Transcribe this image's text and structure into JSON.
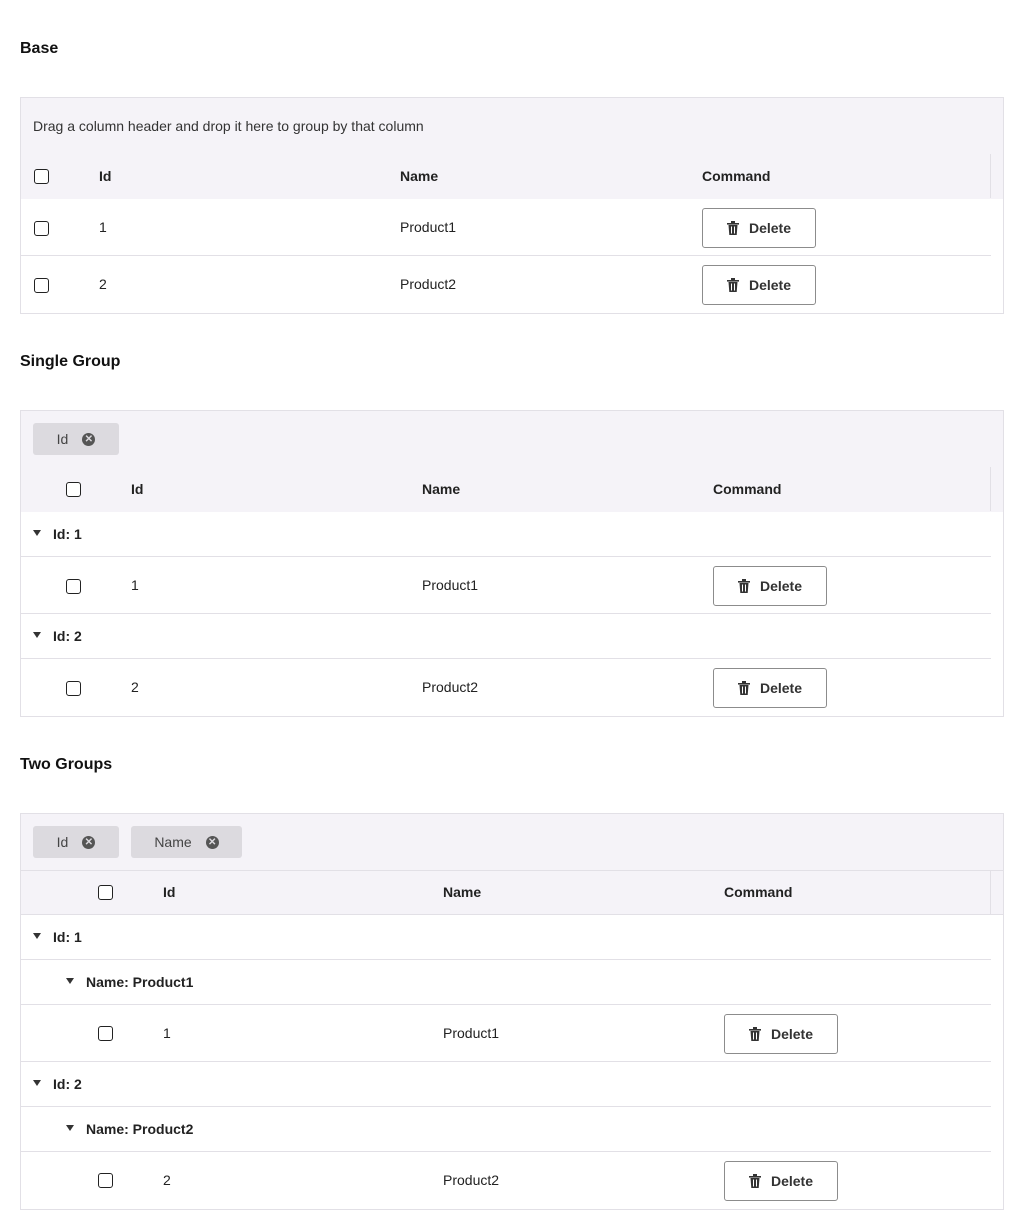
{
  "sections": {
    "base": {
      "title": "Base"
    },
    "single": {
      "title": "Single Group"
    },
    "two": {
      "title": "Two Groups"
    }
  },
  "group_hint": "Drag a column header and drop it here to group by that column",
  "columns": {
    "id": "Id",
    "name": "Name",
    "command": "Command"
  },
  "chips": {
    "id": "Id",
    "name": "Name"
  },
  "delete_label": "Delete",
  "rows": [
    {
      "id": "1",
      "name": "Product1"
    },
    {
      "id": "2",
      "name": "Product2"
    }
  ],
  "groups": {
    "id1": "Id: 1",
    "id2": "Id: 2",
    "name1": "Name: Product1",
    "name2": "Name: Product2"
  },
  "icons": {
    "delete": "trash-icon",
    "remove_group": "close-circle-icon",
    "expand": "caret-down-icon",
    "select": "checkbox"
  }
}
